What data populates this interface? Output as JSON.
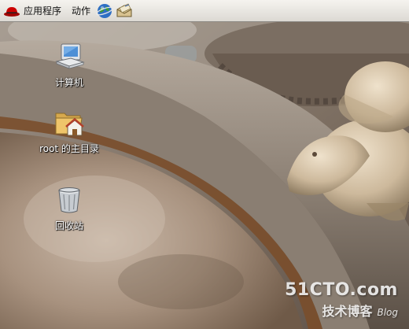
{
  "panel": {
    "apps_label": "应用程序",
    "actions_label": "动作",
    "launchers": [
      {
        "icon": "web-browser-icon"
      },
      {
        "icon": "email-client-icon"
      }
    ]
  },
  "desktop": {
    "icons": [
      {
        "label": "计算机",
        "icon": "computer-icon"
      },
      {
        "label": "root 的主目录",
        "icon": "home-folder-icon"
      },
      {
        "label": "回收站",
        "icon": "trash-icon"
      }
    ]
  },
  "watermark": {
    "site": "51CTO.com",
    "subtitle": "技术博客",
    "blog": "Blog"
  },
  "colors": {
    "panel_background": "#e8e6e2",
    "icon_label_text": "#ffffff",
    "redhat_red": "#cc0000"
  }
}
